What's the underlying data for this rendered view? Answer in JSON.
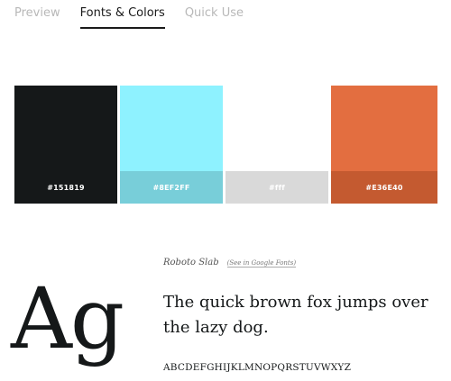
{
  "tabs": [
    {
      "label": "Preview",
      "active": false
    },
    {
      "label": "Fonts & Colors",
      "active": true
    },
    {
      "label": "Quick Use",
      "active": false
    }
  ],
  "colors": [
    {
      "hex_label": "#151819",
      "fill": "#151819",
      "chip_bg": "#151819",
      "chip_text": "#ffffff"
    },
    {
      "hex_label": "#8EF2FF",
      "fill": "#8ef2ff",
      "chip_bg": "#78ced9",
      "chip_text": "#ffffff"
    },
    {
      "hex_label": "#fff",
      "fill": "#ffffff",
      "chip_bg": "#d9d9d9",
      "chip_text": "#ffffff"
    },
    {
      "hex_label": "#E36E40",
      "fill": "#e36e40",
      "chip_bg": "#c45a30",
      "chip_text": "#ffffff"
    }
  ],
  "font": {
    "name": "Roboto Slab",
    "link": "(See in Google Fonts)",
    "specimen_glyphs": "Ag",
    "sentence": "The quick brown fox jumps over the lazy dog.",
    "alphabet": "ABCDEFGHIJKLMNOPQRSTUVWXYZ"
  }
}
